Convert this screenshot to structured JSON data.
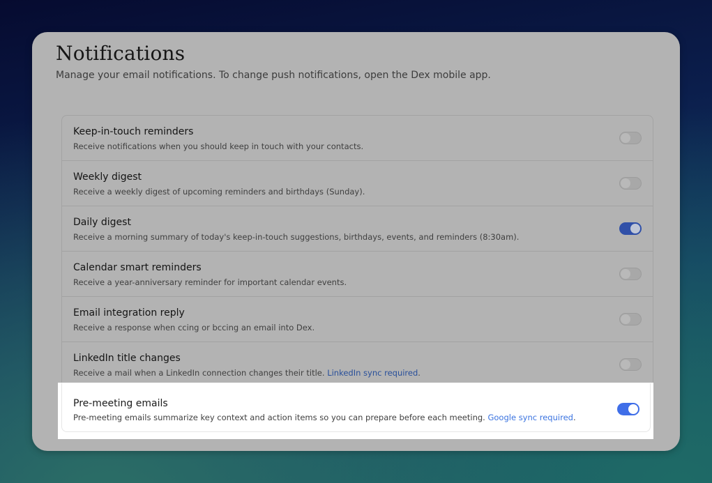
{
  "page": {
    "title": "Notifications",
    "subtitle": "Manage your email notifications. To change push notifications, open the Dex mobile app."
  },
  "settings": [
    {
      "title": "Keep-in-touch reminders",
      "description": "Receive notifications when you should keep in touch with your contacts.",
      "link": "",
      "enabled": false
    },
    {
      "title": "Weekly digest",
      "description": "Receive a weekly digest of upcoming reminders and birthdays (Sunday).",
      "link": "",
      "enabled": false
    },
    {
      "title": "Daily digest",
      "description": "Receive a morning summary of today's keep-in-touch suggestions, birthdays, events, and reminders (8:30am).",
      "link": "",
      "enabled": true
    },
    {
      "title": "Calendar smart reminders",
      "description": "Receive a year-anniversary reminder for important calendar events.",
      "link": "",
      "enabled": false
    },
    {
      "title": "Email integration reply",
      "description": "Receive a response when ccing or bccing an email into Dex.",
      "link": "",
      "enabled": false
    },
    {
      "title": "LinkedIn title changes",
      "description": "Receive a mail when a LinkedIn connection changes their title. ",
      "link": "LinkedIn sync required",
      "enabled": false
    },
    {
      "title": "Pre-meeting emails",
      "description": "Pre-meeting emails summarize key context and action items so you can prepare before each meeting. ",
      "link": "Google sync required",
      "enabled": true
    }
  ],
  "punctuation": {
    "period": "."
  },
  "colors": {
    "toggle_on": "#3f6ee8",
    "link": "#3a73e0",
    "overlay": "#b3b3b3",
    "highlight_bg": "#ffffff"
  }
}
